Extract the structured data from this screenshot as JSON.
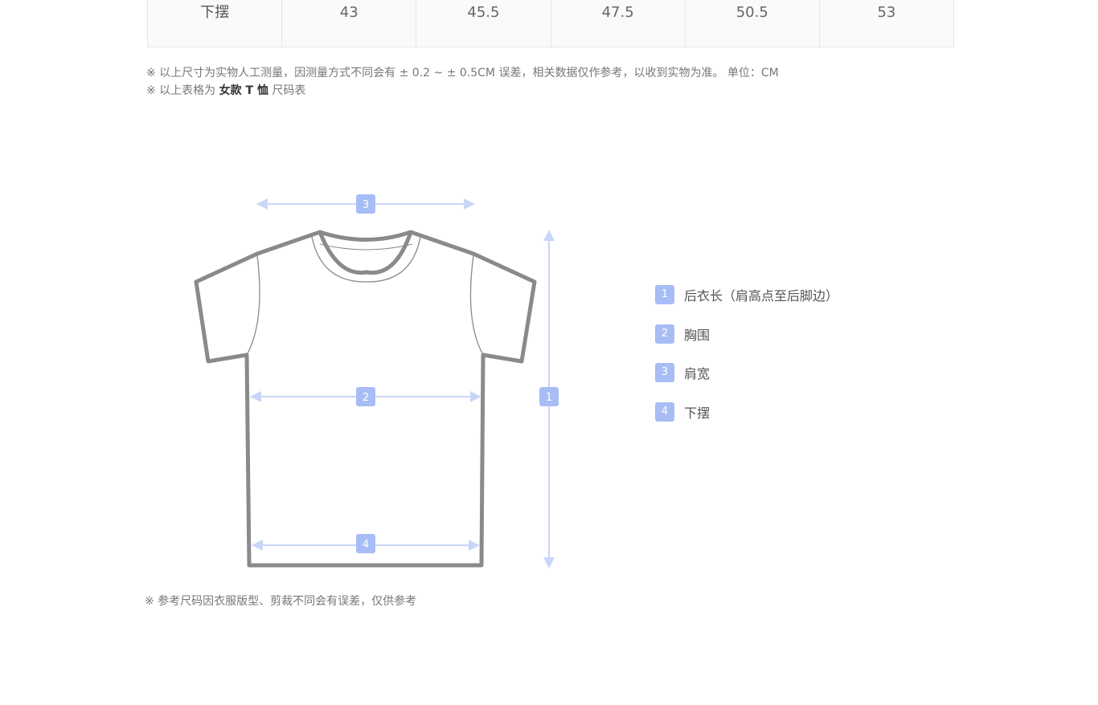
{
  "size_table": {
    "row_label": "下摆",
    "values": [
      "43",
      "45.5",
      "47.5",
      "50.5",
      "53"
    ]
  },
  "notes": {
    "measurement": "※ 以上尺寸为实物人工测量，因测量方式不同会有 ± 0.2 ~ ± 0.5CM 误差，相关数据仅作参考，以收到实物为准。 单位：CM",
    "table_prefix": "※ 以上表格为 ",
    "table_type": "女款 T 恤",
    "table_suffix": " 尺码表",
    "reference": "※ 参考尺码因衣服版型、剪裁不同会有误差，仅供参考"
  },
  "diagram": {
    "markers": {
      "length": "1",
      "chest": "2",
      "shoulder": "3",
      "hem": "4"
    },
    "colors": {
      "shirt_outline": "#8a8a8a",
      "arrow": "#c9d6f7",
      "badge": "#a8bdf5"
    }
  },
  "legend": [
    {
      "num": "1",
      "label": "后衣长（肩高点至后脚边）"
    },
    {
      "num": "2",
      "label": "胸围"
    },
    {
      "num": "3",
      "label": "肩宽"
    },
    {
      "num": "4",
      "label": "下摆"
    }
  ]
}
